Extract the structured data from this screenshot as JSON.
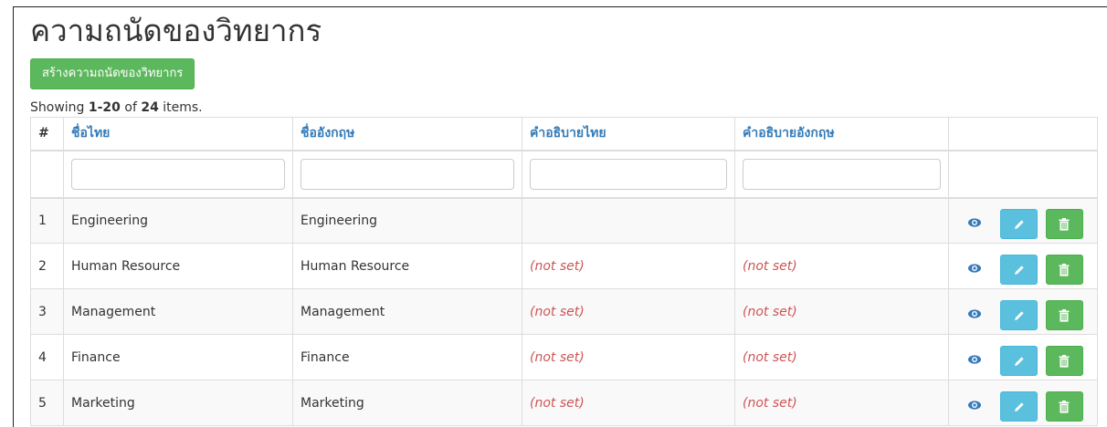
{
  "page": {
    "title": "ความถนัดของวิทยากร",
    "create_button": "สร้างความถนัดของวิทยากร"
  },
  "summary": {
    "prefix": "Showing ",
    "range": "1-20",
    "of": " of ",
    "total": "24",
    "suffix": " items."
  },
  "table": {
    "columns": [
      "#",
      "ชื่อไทย",
      "ชื่ออังกฤษ",
      "คำอธิบายไทย",
      "คำอธิบายอังกฤษ",
      ""
    ],
    "rows": [
      {
        "num": "1",
        "name_th": "Engineering",
        "name_en": "Engineering",
        "desc_th": "",
        "desc_en": ""
      },
      {
        "num": "2",
        "name_th": "Human Resource",
        "name_en": "Human Resource",
        "desc_th": "(not set)",
        "desc_en": "(not set)"
      },
      {
        "num": "3",
        "name_th": "Management",
        "name_en": "Management",
        "desc_th": "(not set)",
        "desc_en": "(not set)"
      },
      {
        "num": "4",
        "name_th": "Finance",
        "name_en": "Finance",
        "desc_th": "(not set)",
        "desc_en": "(not set)"
      },
      {
        "num": "5",
        "name_th": "Marketing",
        "name_en": "Marketing",
        "desc_th": "(not set)",
        "desc_en": "(not set)"
      }
    ]
  },
  "icons": {
    "view": "eye-icon",
    "edit": "pencil-icon",
    "delete": "trash-icon"
  },
  "colors": {
    "success": "#5cb85c",
    "info": "#5bc0de",
    "link": "#337ab7",
    "not_set": "#cc5555"
  }
}
